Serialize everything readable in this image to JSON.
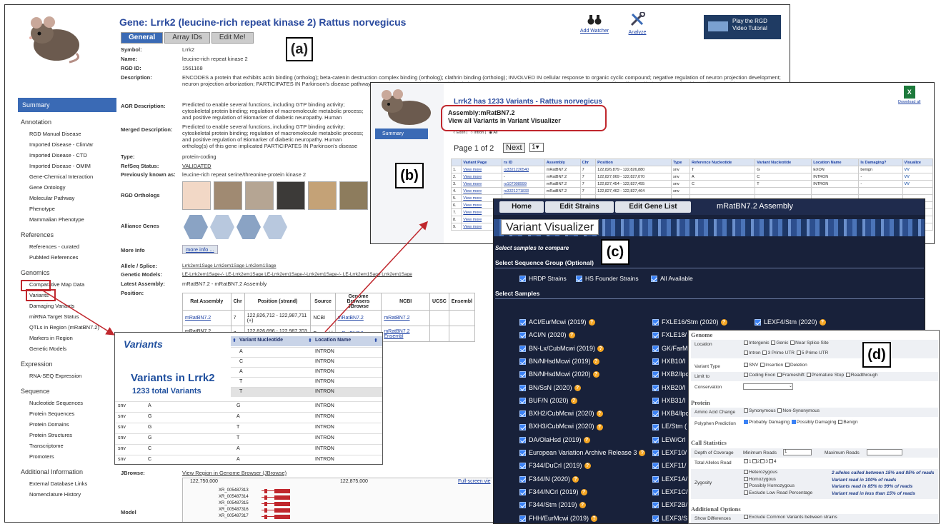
{
  "panel_a": {
    "title": "Gene: Lrrk2 (leucine-rich repeat kinase 2) Rattus norvegicus",
    "tabs": [
      "General",
      "Array IDs",
      "Edit Me!"
    ],
    "toolbar": {
      "watch": "Add Watcher",
      "analyze": "Analyze",
      "video": "Play the RGD Video Tutorial"
    },
    "label": "(a)",
    "sidebar": {
      "summary": "Summary",
      "sections": [
        {
          "title": "Annotation",
          "items": [
            "RGD Manual Disease",
            "Imported Disease - ClinVar",
            "Imported Disease - CTD",
            "Imported Disease - OMIM",
            "Gene-Chemical Interaction",
            "Gene Ontology",
            "Molecular Pathway",
            "Phenotype",
            "Mammalian Phenotype"
          ]
        },
        {
          "title": "References",
          "items": [
            "References - curated",
            "PubMed References"
          ]
        },
        {
          "title": "Genomics",
          "items": [
            "Comparative Map Data",
            "Variants",
            "Damaging Variants",
            "miRNA Target Status",
            "QTLs in Region (mRatBN7.2)",
            "Markers in Region",
            "Genetic Models"
          ]
        },
        {
          "title": "Expression",
          "items": [
            "RNA-SEQ Expression"
          ]
        },
        {
          "title": "Sequence",
          "items": [
            "Nucleotide Sequences",
            "Protein Sequences",
            "Protein Domains",
            "Protein Structures",
            "Transcriptome",
            "Promoters"
          ]
        },
        {
          "title": "Additional Information",
          "items": [
            "External Database Links",
            "Nomenclature History"
          ]
        }
      ]
    },
    "fields": {
      "symbol_l": "Symbol:",
      "symbol": "Lrrk2",
      "name_l": "Name:",
      "name": "leucine-rich repeat kinase 2",
      "rgd_l": "RGD ID:",
      "rgd": "1561168",
      "desc_l": "Description:",
      "desc": "ENCODES a protein that exhibits actin binding (ortholog); beta-catenin destruction complex binding (ortholog); clathrin binding (ortholog); INVOLVED IN cellular response to organic cyclic compound; negative regulation of neuron projection development; neuron projection arborization; PARTICIPATES IN Parkinson's disease pathway; ASSOCIATED WITH decreased circulating aspartate transaminase level; ASSOCIATED WITH tetrachlorodibenzodioxine; 6-propyl-2-thiouracil; acetamide",
      "agr_l": "AGR Description:",
      "agr": "Predicted to enable several functions, including GTP binding activity; cytoskeletal protein binding; regulation of macromolecule metabolic process; and positive regulation of Biomarker of diabetic neuropathy. Human ortholog(s) of this gene implicated",
      "merged_l": "Merged Description:",
      "merged": "Predicted to enable several functions, including GTP binding activity; cytoskeletal protein binding; regulation of macromolecule metabolic process; and positive regulation of Biomarker of diabetic neuropathy. Human ortholog(s) of this gene implicated PARTICIPATES IN Parkinson's disease pathway; INTERACTS WITH 2,3,7,",
      "type_l": "Type:",
      "type": "protein-coding",
      "refseq_l": "RefSeq Status:",
      "refseq": "VALIDATED",
      "prev_l": "Previously known as:",
      "prev": "leucine-rich repeat serine/threonine-protein kinase 2",
      "orth_l": "RGD Orthologs",
      "alliance_l": "Alliance Genes",
      "more_l": "More Info",
      "more": "more info ...",
      "allele_l": "Allele / Splice:",
      "allele": "Lrrk2em1Sage Lrrk2em1Sage Lrrk2em1Sage",
      "genmod_l": "Genetic Models:",
      "genmod": "LE-Lrrk2em1Sage-/- LE-Lrrk2em1Sage LE-Lrrk2em1Sage-/-Lrrk2em1Sage-/- LE-Lrrk2em1Sage Lrrk2em1Sage",
      "latest_l": "Latest Assembly:",
      "latest": "mRatBN7.2 - mRatBN7.2 Assembly",
      "position_l": "Position:",
      "jbrowse_l": "JBrowse:",
      "jbrowse": "View Region in Genome Browser (JBrowse)",
      "model_l": "Model"
    },
    "assembly_table": {
      "headers": [
        "Rat Assembly",
        "Chr",
        "Position (strand)",
        "Source",
        "JBrowse",
        "NCBI",
        "UCSC",
        "Ensembl"
      ],
      "browsers_l": "Genome Browsers",
      "rows": [
        [
          "mRatBN7.2",
          "7",
          "122,826,712 - 122,987,711 (+)",
          "NCBI",
          "mRatBN7.2",
          "mRatBN7.2"
        ],
        [
          "mRatBN7.2 Ensembl",
          "7",
          "122,826,696 - 122,987,703 (+)",
          "Ensembl",
          "mRatBN7.2",
          "mRatBN7.2 Ensembl"
        ]
      ]
    },
    "browser": {
      "t1": "122,750,000",
      "t2": "122,875,000",
      "full": "Full-screen vie",
      "tracks": [
        "XR_005487313",
        "XR_005487314",
        "XR_005487315",
        "XR_005487316",
        "XR_005487317"
      ]
    }
  },
  "panel_b": {
    "title": "Lrrk2 has 1233 Variants - Rattus norvegicus",
    "assembly": "Assembly:mRatBN7.2",
    "view_all": "View all Variants in Variant Visualizer",
    "filters": [
      "Exon",
      "Intron",
      "All"
    ],
    "summary": "Summary",
    "download": "Download all",
    "paging": "Page 1 of 2",
    "next": "Next",
    "page_sel": "1",
    "label": "(b)",
    "headers": [
      "",
      "Variant Page",
      "rs ID",
      "Assembly",
      "Chr",
      "Position",
      "Type",
      "Reference Nucleotide",
      "Variant Nucleotide",
      "Location Name",
      "Is Damaging?",
      "Visualize"
    ],
    "rows": [
      [
        "1.",
        "View more",
        "rs3321226540",
        "mRatBN7.2",
        "7",
        "122,826,879 - 122,826,880",
        "snv",
        "T",
        "G",
        "EXON",
        "benign",
        "VV"
      ],
      [
        "2.",
        "View more",
        "-",
        "mRatBN7.2",
        "7",
        "122,827,069 - 122,827,070",
        "snv",
        "A",
        "C",
        "INTRON",
        "-",
        "VV"
      ],
      [
        "3.",
        "View more",
        "rs107008999",
        "mRatBN7.2",
        "7",
        "122,827,454 - 122,827,455",
        "snv",
        "C",
        "T",
        "INTRON",
        "-",
        "VV"
      ],
      [
        "4.",
        "View more",
        "rs3321271833",
        "mRatBN7.2",
        "7",
        "122,827,462 - 122,827,464",
        "snv",
        "",
        "",
        "",
        "",
        ""
      ],
      [
        "5.",
        "View more",
        "",
        "",
        "",
        "",
        "",
        "",
        "",
        "",
        "",
        ""
      ],
      [
        "6.",
        "View more",
        "",
        "",
        "",
        "",
        "",
        "",
        "",
        "",
        "",
        ""
      ],
      [
        "7.",
        "View more",
        "",
        "",
        "",
        "",
        "",
        "",
        "",
        "",
        "",
        ""
      ],
      [
        "8.",
        "View more",
        "",
        "",
        "",
        "",
        "",
        "",
        "",
        "",
        "",
        ""
      ],
      [
        "9.",
        "View more",
        "",
        "",
        "",
        "",
        "",
        "",
        "",
        "",
        "",
        ""
      ]
    ]
  },
  "panel_c": {
    "nav": [
      "Home",
      "Edit Strains",
      "Edit Gene List"
    ],
    "assembly": "mRatBN7.2 Assembly",
    "title": "Variant Visualizer",
    "label": "(c)",
    "select_compare": "Select samples to compare",
    "seq_group": "Select Sequence Group (Optional)",
    "groups": [
      "HRDP Strains",
      "HS Founder Strains",
      "All Available"
    ],
    "select_samples": "Select Samples",
    "col1": [
      "ACI/EurMcwi (2019)",
      "ACI/N (2020)",
      "BN-Lx/CubMcwi (2019)",
      "BN/NHsdMcwi (2019)",
      "BN/NHsdMcwi (2020)",
      "BN/SsN (2020)",
      "BUF/N (2020)",
      "BXH2/CubMcwi (2020)",
      "BXH3/CubMcwi (2020)",
      "DA/OlaHsd (2019)",
      "European Variation Archive Release 3",
      "F344/DuCrl (2019)",
      "F344/N (2020)",
      "F344/NCrl (2019)",
      "F344/Stm (2019)",
      "FHH/EurMcwi (2019)"
    ],
    "col2": [
      "FXLE16/Stm (2020)",
      "FXLE18/",
      "GK/FarM",
      "HXB10/I",
      "HXB2/Ipc",
      "HXB20/I",
      "HXB31/I",
      "HXB4/Ipc",
      "LE/Stm (",
      "LEW/Crl",
      "LEXF10/",
      "LEXF11/",
      "LEXF1A/",
      "LEXF1C/",
      "LEXF2B/",
      "LEXF3/S"
    ],
    "col3": [
      "LEXF4/Stm (2020)"
    ]
  },
  "panel_d": {
    "label": "(d)",
    "genome": "Genome",
    "location_l": "Location",
    "location": [
      "Intergenic",
      "Genic",
      "Near Splice Site",
      "Intron",
      "3 Prime UTR",
      "5 Prime UTR"
    ],
    "vtype_l": "Variant Type",
    "vtype": [
      "SNV",
      "Insertion",
      "Deletion"
    ],
    "limit_l": "Limit to",
    "limit": [
      "Coding Exon",
      "Frameshift",
      "Premature Stop",
      "Readthrough"
    ],
    "cons_l": "Conservation",
    "protein": "Protein",
    "aac_l": "Amino Acid Change",
    "aac": [
      "Synonymous",
      "Non-Synonymous"
    ],
    "poly_l": "Polyphen Prediction",
    "poly": [
      "Probably Damaging",
      "Possibly Damaging",
      "Benign"
    ],
    "call": "Call Statistics",
    "depth_l": "Depth of Coverage",
    "min_l": "Minimum Reads",
    "min": "1",
    "max_l": "Maximum Reads",
    "total_l": "Total Alleles Read",
    "total": [
      "1",
      "2",
      "3",
      "4"
    ],
    "zyg_l": "Zygosity",
    "zyg": [
      "Heterozygous",
      "Homozygous",
      "Possibly Homozygous",
      "Exclude Low Read Percentage"
    ],
    "zyg_notes": [
      "2 alleles called between 15% and 85% of reads",
      "Variant read in 100% of reads",
      "Variants read in 85% to 99% of reads",
      "Variant read in less than 15% of reads"
    ],
    "addl": "Additional Options",
    "diff_l": "Show Differences",
    "diff": "Exclude Common Variants between strains"
  },
  "variants_popup": {
    "title": "Variants",
    "heading": "Variants in Lrrk2",
    "count": "1233 total Variants",
    "headers": [
      "Variant Nucleotide",
      "Location Name"
    ],
    "top_rows": [
      [
        "A",
        "INTRON"
      ],
      [
        "C",
        "INTRON"
      ],
      [
        "A",
        "INTRON"
      ],
      [
        "T",
        "INTRON"
      ],
      [
        "T",
        "INTRON"
      ]
    ],
    "rows": [
      [
        "snv",
        "A",
        "G",
        "INTRON"
      ],
      [
        "snv",
        "G",
        "A",
        "INTRON"
      ],
      [
        "snv",
        "G",
        "T",
        "INTRON"
      ],
      [
        "snv",
        "G",
        "T",
        "INTRON"
      ],
      [
        "snv",
        "C",
        "A",
        "INTRON"
      ],
      [
        "snv",
        "C",
        "A",
        "INTRON"
      ]
    ]
  },
  "colors": {
    "accent": "#3a6ab5",
    "highlight": "#c0272d",
    "vv_bg": "#18213a"
  }
}
